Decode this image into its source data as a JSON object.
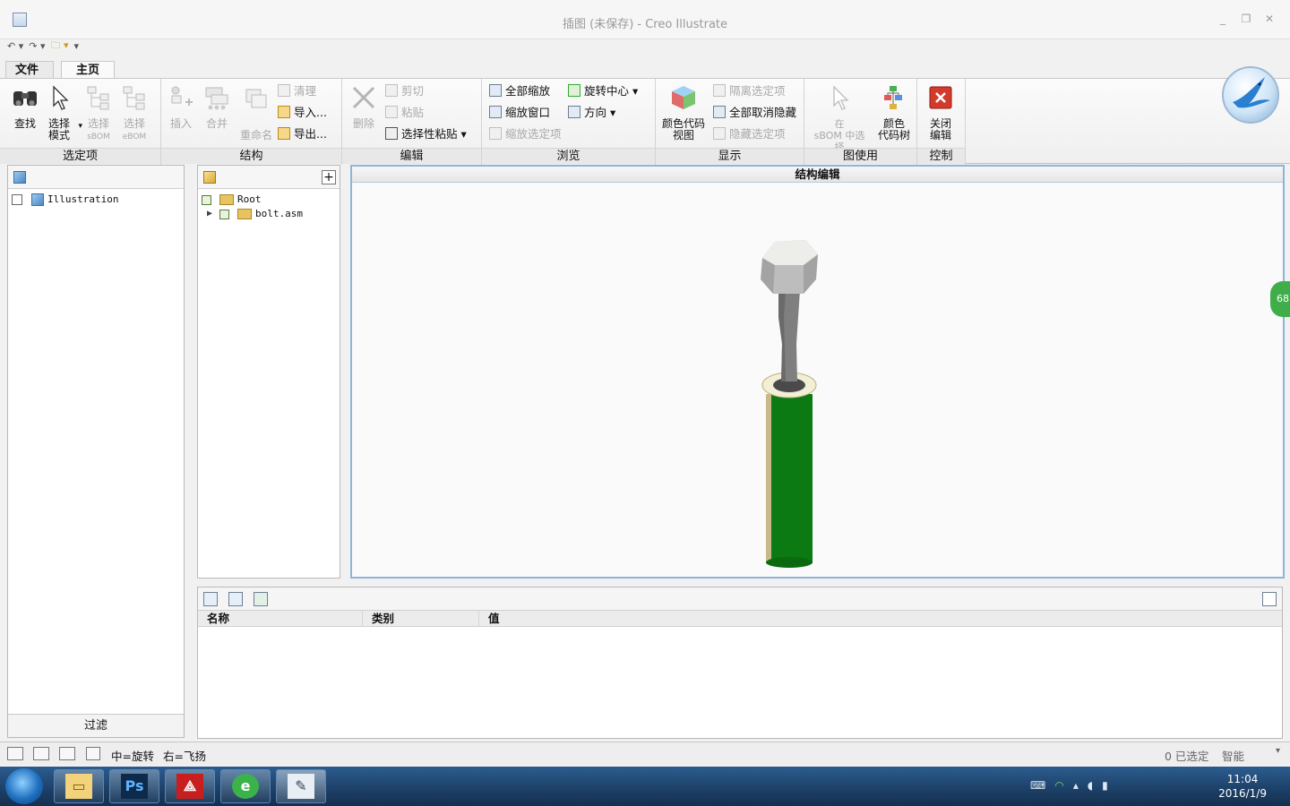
{
  "window": {
    "title": "插图 (未保存) - Creo Illustrate"
  },
  "tabs": {
    "file": "文件",
    "home": "主页"
  },
  "ribbon": {
    "groups": {
      "selection": "选定项",
      "structure": "结构",
      "edit": "编辑",
      "browse": "浏览",
      "display": "显示",
      "figure_use": "图使用",
      "control": "控制"
    },
    "find": "查找",
    "select_mode": "选择\n模式",
    "select_sbom": "选择",
    "select_sbom_sub": "sBOM",
    "select_ebom": "选择",
    "select_ebom_sub": "eBOM",
    "insert": "插入",
    "merge": "合并",
    "rename": "重命名",
    "cleanup": "清理",
    "import": "导入...",
    "export": "导出...",
    "delete": "删除",
    "cut": "剪切",
    "paste": "粘贴",
    "paste_special": "选择性粘贴",
    "zoom_all": "全部缩放",
    "zoom_window": "缩放窗口",
    "zoom_selected": "缩放选定项",
    "spin_center": "旋转中心",
    "orientation": "方向",
    "color_code_view": "颜色代码\n视图",
    "isolate_selected": "隔离选定项",
    "unhide_all": "全部取消隐藏",
    "hide_selected": "隐藏选定项",
    "in_sbom_select": "在\nsBOM 中选择",
    "color_code_tree": "颜色\n代码树",
    "close_edit": "关闭\n编辑"
  },
  "selection_tree": {
    "root": "Illustration",
    "filter": "过滤"
  },
  "structure_tree": {
    "root": "Root",
    "child": "bolt.asm"
  },
  "viewport": {
    "title": "结构编辑"
  },
  "properties": {
    "columns": [
      "名称",
      "类别",
      "值"
    ]
  },
  "status": {
    "middle": "中=旋转",
    "right": "右=飞扬",
    "selected": "0 已选定",
    "mode": "智能"
  },
  "taskbar": {
    "time": "11:04",
    "date": "2016/1/9"
  },
  "side_badge": "68",
  "colors": {
    "bolt_body": "#7f7f7f",
    "bolt_head": "#ededea",
    "cylinder": "#0b7a12",
    "accent": "#1f6fbf"
  }
}
